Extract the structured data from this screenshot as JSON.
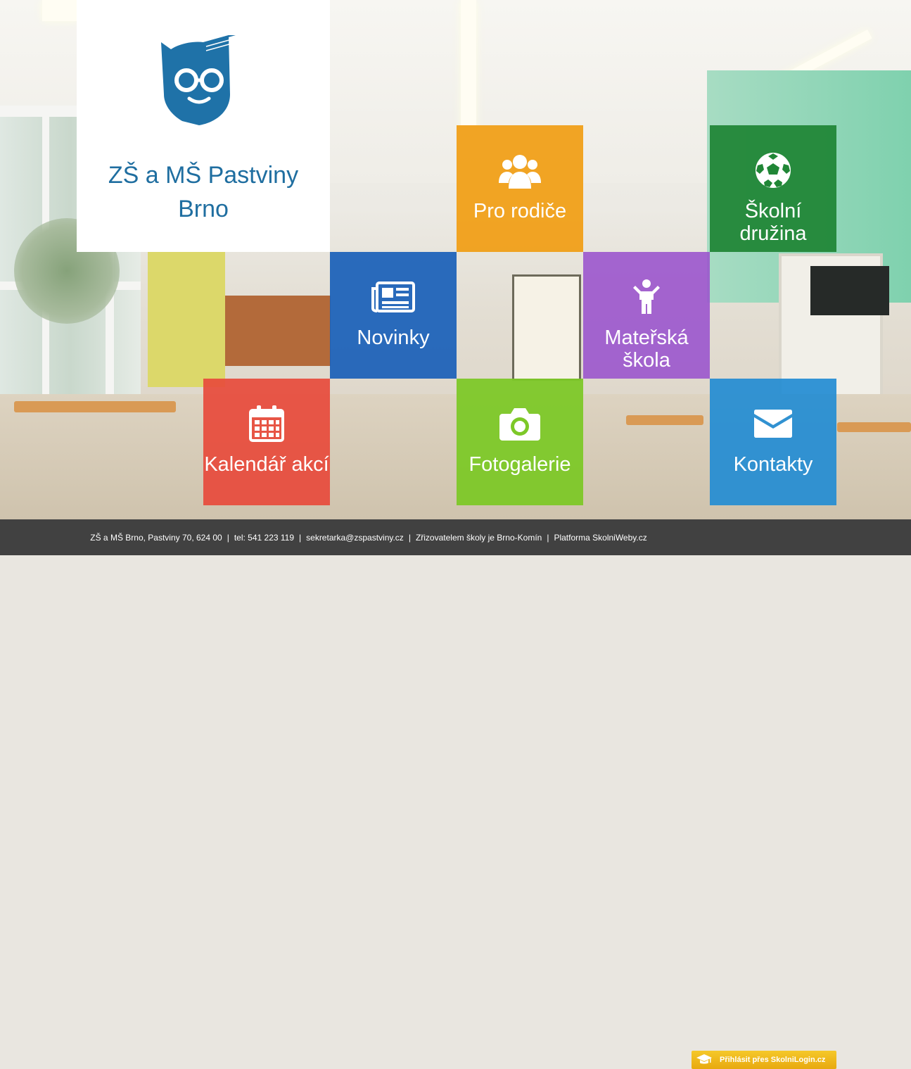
{
  "school": {
    "name": "ZŠ a MŠ Pastviny\nBrno"
  },
  "tiles": [
    {
      "id": "pro-rodice",
      "label": "Pro rodiče",
      "icon": "parents-group-icon",
      "color": "#f0a01b"
    },
    {
      "id": "skolni-druzina",
      "label": "Školní\ndružina",
      "icon": "soccer-ball-icon",
      "color": "#208636"
    },
    {
      "id": "novinky",
      "label": "Novinky",
      "icon": "newspaper-icon",
      "color": "#195fb9"
    },
    {
      "id": "materska-skola",
      "label": "Mateřská\nškola",
      "icon": "child-icon",
      "color": "#9b55cd"
    },
    {
      "id": "kalendar-akci",
      "label": "Kalendář akcí",
      "icon": "calendar-icon",
      "color": "#e74b3c"
    },
    {
      "id": "fotogalerie",
      "label": "Fotogalerie",
      "icon": "camera-icon",
      "color": "#7dc828"
    },
    {
      "id": "kontakty",
      "label": "Kontakty",
      "icon": "envelope-icon",
      "color": "#238cd2"
    }
  ],
  "footer": {
    "address": "ZŠ a MŠ Brno, Pastviny 70, 624 00",
    "phone": "tel: 541 223 119",
    "email": "sekretarka@zspastviny.cz",
    "founder": "Zřizovatelem školy je Brno-Komín",
    "platform": "Platforma SkolniWeby.cz",
    "separator": "|",
    "login_label": "Přihlásit přes SkolniLogin.cz",
    "login_icon": "graduation-cap-icon"
  }
}
